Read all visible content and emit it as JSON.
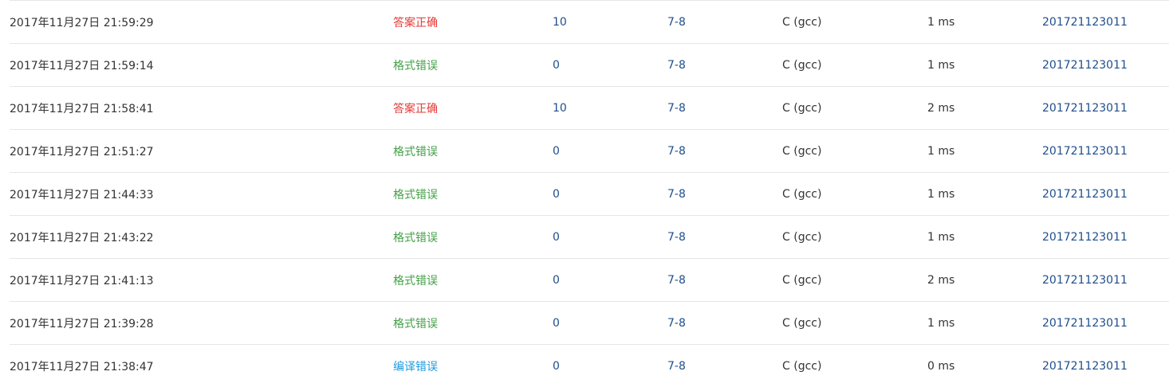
{
  "colors": {
    "accepted": "#e53935",
    "presentation_error": "#43a047",
    "compile_error": "#1e9be0",
    "link": "#1f4e8c",
    "text": "#333333",
    "row_border": "#e6e6e6"
  },
  "rows": [
    {
      "time": "2017年11月27日 21:59:29",
      "status": "答案正确",
      "status_type": "accepted",
      "score": "10",
      "problem": "7-8",
      "compiler": "C (gcc)",
      "time_used": "1 ms",
      "user": "201721123011"
    },
    {
      "time": "2017年11月27日 21:59:14",
      "status": "格式错误",
      "status_type": "presentation_error",
      "score": "0",
      "problem": "7-8",
      "compiler": "C (gcc)",
      "time_used": "1 ms",
      "user": "201721123011"
    },
    {
      "time": "2017年11月27日 21:58:41",
      "status": "答案正确",
      "status_type": "accepted",
      "score": "10",
      "problem": "7-8",
      "compiler": "C (gcc)",
      "time_used": "2 ms",
      "user": "201721123011"
    },
    {
      "time": "2017年11月27日 21:51:27",
      "status": "格式错误",
      "status_type": "presentation_error",
      "score": "0",
      "problem": "7-8",
      "compiler": "C (gcc)",
      "time_used": "1 ms",
      "user": "201721123011"
    },
    {
      "time": "2017年11月27日 21:44:33",
      "status": "格式错误",
      "status_type": "presentation_error",
      "score": "0",
      "problem": "7-8",
      "compiler": "C (gcc)",
      "time_used": "1 ms",
      "user": "201721123011"
    },
    {
      "time": "2017年11月27日 21:43:22",
      "status": "格式错误",
      "status_type": "presentation_error",
      "score": "0",
      "problem": "7-8",
      "compiler": "C (gcc)",
      "time_used": "1 ms",
      "user": "201721123011"
    },
    {
      "time": "2017年11月27日 21:41:13",
      "status": "格式错误",
      "status_type": "presentation_error",
      "score": "0",
      "problem": "7-8",
      "compiler": "C (gcc)",
      "time_used": "2 ms",
      "user": "201721123011"
    },
    {
      "time": "2017年11月27日 21:39:28",
      "status": "格式错误",
      "status_type": "presentation_error",
      "score": "0",
      "problem": "7-8",
      "compiler": "C (gcc)",
      "time_used": "1 ms",
      "user": "201721123011"
    },
    {
      "time": "2017年11月27日 21:38:47",
      "status": "编译错误",
      "status_type": "compile_error",
      "score": "0",
      "problem": "7-8",
      "compiler": "C (gcc)",
      "time_used": "0 ms",
      "user": "201721123011"
    }
  ]
}
